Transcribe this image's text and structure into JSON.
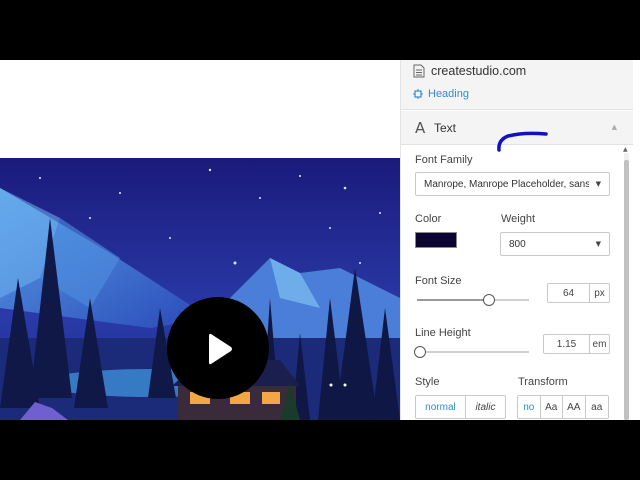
{
  "colors": {
    "letterbox": "#000000",
    "link_accent": "#2f8ec9",
    "swatch": "#0c0531",
    "play_button": "#000000",
    "annotation_pen": "#1010c8"
  },
  "panel": {
    "breadcrumb": {
      "site_icon": "document-icon",
      "site_label": "createstudio.com",
      "heading_icon": "frame-icon",
      "heading_label": "Heading"
    },
    "section": {
      "icon": "text-a-icon",
      "title": "Text",
      "caret": "▲"
    },
    "font_family": {
      "label": "Font Family",
      "value": "Manrope, Manrope Placeholder, sans-serif",
      "chevron": "▼"
    },
    "color": {
      "label": "Color",
      "value": "#0c0531"
    },
    "weight": {
      "label": "Weight",
      "value": "800",
      "chevron": "▼"
    },
    "font_size": {
      "label": "Font Size",
      "value": "64",
      "unit": "px",
      "slider_fraction": 0.64
    },
    "line_height": {
      "label": "Line Height",
      "value": "1.15",
      "unit": "em",
      "slider_fraction": 0
    },
    "style": {
      "label": "Style",
      "options": [
        "normal",
        "italic"
      ],
      "selected": "normal"
    },
    "transform": {
      "label": "Transform",
      "options": [
        "no",
        "Aa",
        "AA",
        "aa"
      ],
      "selected": "no"
    }
  },
  "video": {
    "play_icon": "play-icon"
  }
}
